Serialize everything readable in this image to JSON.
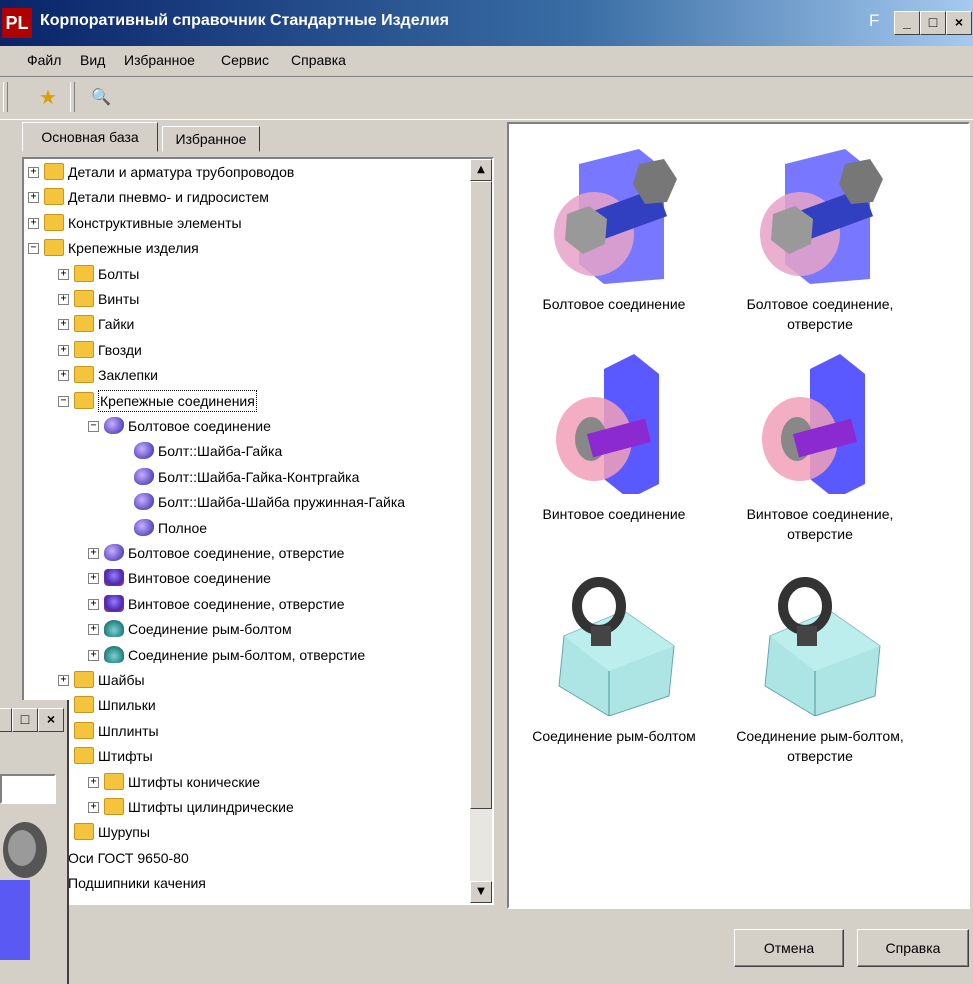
{
  "window": {
    "logo_text": "PL",
    "title": "Корпоративный справочник Стандартные Изделия",
    "f_glyph": "F",
    "controls": [
      "_",
      "□",
      "×"
    ]
  },
  "menu": [
    "Файл",
    "Вид",
    "Избранное",
    "Сервис",
    "Справка"
  ],
  "toolbar": {
    "buttons": [
      {
        "name": "add-favorite-icon",
        "glyph": "★"
      },
      {
        "name": "binoculars-icon",
        "glyph": "🔍"
      }
    ]
  },
  "tabs": [
    "Основная база",
    "Избранное"
  ],
  "tree": [
    {
      "label": "Детали и арматура трубопроводов",
      "level": 0,
      "exp": "+",
      "icon": "folder"
    },
    {
      "label": "Детали пневмо- и гидросистем",
      "level": 0,
      "exp": "+",
      "icon": "folder"
    },
    {
      "label": "Конструктивные элементы",
      "level": 0,
      "exp": "+",
      "icon": "folder"
    },
    {
      "label": "Крепежные изделия",
      "level": 0,
      "exp": "-",
      "icon": "folder"
    },
    {
      "label": "Болты",
      "level": 1,
      "exp": "+",
      "icon": "folder"
    },
    {
      "label": "Винты",
      "level": 1,
      "exp": "+",
      "icon": "folder"
    },
    {
      "label": "Гайки",
      "level": 1,
      "exp": "+",
      "icon": "folder"
    },
    {
      "label": "Гвозди",
      "level": 1,
      "exp": "+",
      "icon": "folder"
    },
    {
      "label": "Заклепки",
      "level": 1,
      "exp": "+",
      "icon": "folder"
    },
    {
      "label": "Крепежные соединения",
      "level": 1,
      "exp": "-",
      "icon": "folder",
      "selected": true
    },
    {
      "label": "Болтовое соединение",
      "level": 2,
      "exp": "-",
      "icon": "conn"
    },
    {
      "label": "Болт::Шайба-Гайка",
      "level": 3,
      "exp": "",
      "icon": "conn"
    },
    {
      "label": "Болт::Шайба-Гайка-Контргайка",
      "level": 3,
      "exp": "",
      "icon": "conn"
    },
    {
      "label": "Болт::Шайба-Шайба пружинная-Гайка",
      "level": 3,
      "exp": "",
      "icon": "conn"
    },
    {
      "label": "Полное",
      "level": 3,
      "exp": "",
      "icon": "conn"
    },
    {
      "label": "Болтовое соединение, отверстие",
      "level": 2,
      "exp": "+",
      "icon": "conn"
    },
    {
      "label": "Винтовое соединение",
      "level": 2,
      "exp": "+",
      "icon": "screw"
    },
    {
      "label": "Винтовое соединение, отверстие",
      "level": 2,
      "exp": "+",
      "icon": "screw"
    },
    {
      "label": "Соединение рым-болтом",
      "level": 2,
      "exp": "+",
      "icon": "eye"
    },
    {
      "label": "Соединение рым-болтом, отверстие",
      "level": 2,
      "exp": "+",
      "icon": "eye"
    },
    {
      "label": "Шайбы",
      "level": 1,
      "exp": "+",
      "icon": "folder"
    },
    {
      "label": "Шпильки",
      "level": 1,
      "exp": "",
      "icon": "folder"
    },
    {
      "label": "Шплинты",
      "level": 1,
      "exp": "",
      "icon": "folder"
    },
    {
      "label": "Штифты",
      "level": 1,
      "exp": "",
      "icon": "folder"
    },
    {
      "label": "Штифты конические",
      "level": 2,
      "exp": "+",
      "icon": "folder"
    },
    {
      "label": "Штифты цилиндрические",
      "level": 2,
      "exp": "+",
      "icon": "folder"
    },
    {
      "label": "Шурупы",
      "level": 1,
      "exp": "",
      "icon": "folder"
    },
    {
      "label": "Оси ГОСТ 9650-80",
      "level": 0,
      "exp": "",
      "icon": "folder"
    },
    {
      "label": "Подшипники качения",
      "level": 0,
      "exp": "",
      "icon": "folder"
    }
  ],
  "gallery": [
    {
      "label": "Болтовое соединение",
      "kind": "bolt"
    },
    {
      "label": "Болтовое соединение, отверстие",
      "kind": "bolt"
    },
    {
      "label": "Винтовое соединение",
      "kind": "screw"
    },
    {
      "label": "Винтовое соединение, отверстие",
      "kind": "screw"
    },
    {
      "label": "Соединение рым-болтом",
      "kind": "eye"
    },
    {
      "label": "Соединение рым-болтом, отверстие",
      "kind": "eye"
    }
  ],
  "buttons": {
    "cancel": "Отмена",
    "help": "Справка"
  },
  "colors": {
    "title_start": "#0a246a",
    "title_end": "#a6caf0",
    "face": "#d4d0c8",
    "folder": "#f3c43c"
  }
}
